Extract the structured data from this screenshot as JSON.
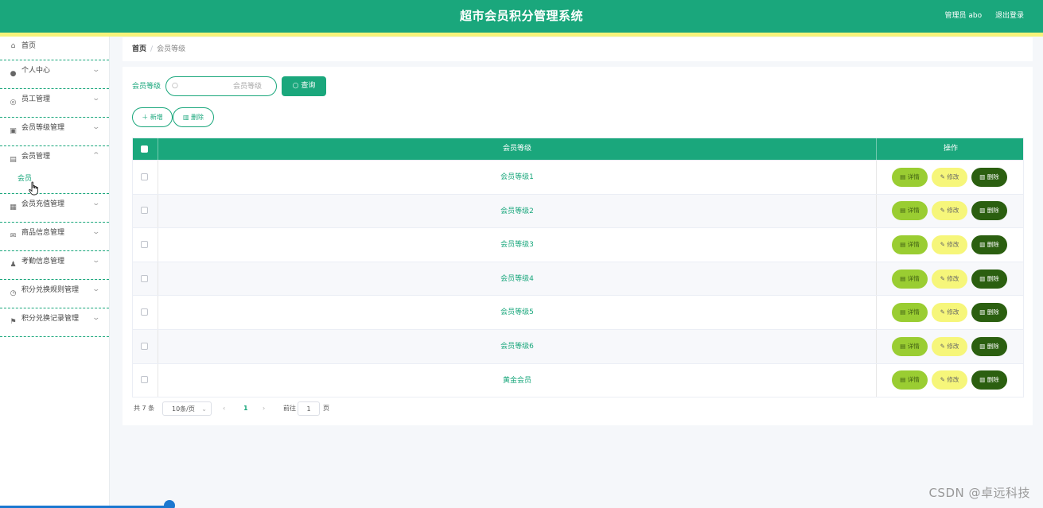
{
  "header": {
    "title": "超市会员积分管理系统",
    "user": "管理员 abo",
    "logout": "退出登录"
  },
  "sidebar": {
    "items": [
      {
        "label": "首页",
        "icon": "home-icon",
        "glyph": "⌂"
      },
      {
        "label": "个人中心",
        "icon": "user-icon",
        "glyph": "●"
      },
      {
        "label": "员工管理",
        "icon": "globe-icon",
        "glyph": "◎"
      },
      {
        "label": "会员等级管理",
        "icon": "chart-icon",
        "glyph": "▣"
      },
      {
        "label": "会员管理",
        "icon": "chat-icon",
        "glyph": "▤"
      },
      {
        "label": "会员充值管理",
        "icon": "grid-icon",
        "glyph": "▦"
      },
      {
        "label": "商品信息管理",
        "icon": "mail-icon",
        "glyph": "✉"
      },
      {
        "label": "考勤信息管理",
        "icon": "person-icon",
        "glyph": "♟"
      },
      {
        "label": "积分兑换规则管理",
        "icon": "clock-icon",
        "glyph": "◷"
      },
      {
        "label": "积分兑换记录管理",
        "icon": "flag-icon",
        "glyph": "⚑"
      }
    ],
    "submenu_label": "会员"
  },
  "breadcrumb": {
    "home": "首页",
    "separator": "/",
    "current": "会员等级"
  },
  "search": {
    "label": "会员等级",
    "placeholder": "会员等级",
    "query_button": "查询"
  },
  "actions": {
    "add": "新增",
    "delete": "删除"
  },
  "table": {
    "headers": [
      "会员等级",
      "操作"
    ],
    "rows": [
      "会员等级1",
      "会员等级2",
      "会员等级3",
      "会员等级4",
      "会员等级5",
      "会员等级6",
      "黄金会员"
    ],
    "row_actions": {
      "detail": "详情",
      "edit": "修改",
      "delete": "删除"
    }
  },
  "pagination": {
    "total": "共 7 条",
    "page_size": "10条/页",
    "current_page": "1",
    "goto_label": "前往",
    "goto_value": "1",
    "page_suffix": "页"
  },
  "watermark": "CSDN @卓远科技",
  "colors": {
    "primary": "#1aa77c",
    "accent_yellow": "#f6f37a",
    "detail_btn": "#9acd32",
    "edit_btn": "#f6f67a",
    "delete_btn": "#2b5f10"
  }
}
